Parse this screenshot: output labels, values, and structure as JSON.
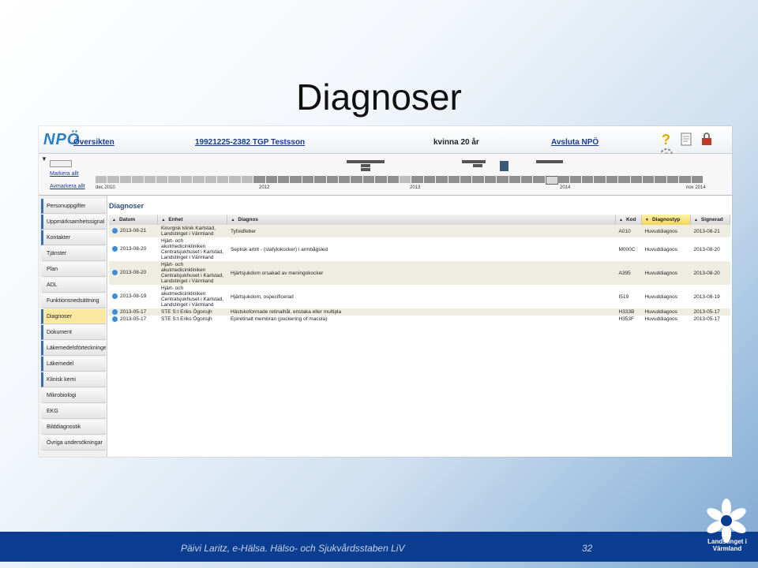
{
  "slide": {
    "title": "Diagnoser",
    "footer_text": "Päivi Laritz, e-Hälsa. Hälso- och Sjukvårdsstaben LiV",
    "page_number": "32",
    "logo_text": "Landstinget i Värmland",
    "colors": {
      "footer": "#0b3d91",
      "accent": "#2a7fbf",
      "active_menu": "#fbe9a1"
    }
  },
  "app": {
    "logo": "NPÖ",
    "nav": {
      "overview": "Översikten",
      "patient": "19921225-2382 TGP Testsson",
      "demographics": "kvinna 20 år",
      "logout": "Avsluta NPÖ"
    },
    "icons": [
      "help-icon",
      "note-icon",
      "lock-icon",
      "settings-icon"
    ]
  },
  "timeline": {
    "mark_all": "Markera allt",
    "unmark_all": "Avmarkera allt",
    "labels": [
      "dec 2010",
      "2012",
      "2013",
      "2014",
      "nov 2014"
    ]
  },
  "menu": [
    "Personuppgifter",
    "Uppmärksamhetssignal",
    "Kontakter",
    "Tjänster",
    "Plan",
    "ADL",
    "Funktionsnedsättning",
    "Diagnoser",
    "Dokument",
    "Läkemedelsförteckningen",
    "Läkemedel",
    "Klinisk kemi",
    "Mikrobiologi",
    "EKG",
    "Bilddiagnostik",
    "Övriga undersökningar"
  ],
  "content": {
    "title": "Diagnoser",
    "columns": [
      "Datum",
      "Enhet",
      "Diagnos",
      "Kod",
      "Diagnostyp",
      "Signerad"
    ],
    "rows": [
      {
        "datum": "2013-08-21",
        "enhet": "Kirurgisk klinik Karlstad, Landstinget i Värmland",
        "diagnos": "Tyfoidfeber",
        "kod": "A010",
        "typ": "Huvuddiagnos",
        "signerad": "2013-08-21"
      },
      {
        "datum": "2013-08-20",
        "enhet": "Hjärt- och akutmedicinkliniken Centralsjukhuset i Karlstad, Landstinget i Värmland",
        "diagnos": "Septisk artrit - (stafylokocker) i armbågsled",
        "kod": "M000C",
        "typ": "Huvuddiagnos",
        "signerad": "2013-08-20"
      },
      {
        "datum": "2013-08-20",
        "enhet": "Hjärt- och akutmedicinkliniken Centralsjukhuset i Karlstad, Landstinget i Värmland",
        "diagnos": "Hjärtsjukdom orsakad av meningokocker",
        "kod": "A395",
        "typ": "Huvuddiagnos",
        "signerad": "2013-08-20"
      },
      {
        "datum": "2013-08-19",
        "enhet": "Hjärt- och akutmedicinkliniken Centralsjukhuset i Karlstad, Landstinget i Värmland",
        "diagnos": "Hjärtsjukdom, ospecificerad",
        "kod": "I519",
        "typ": "Huvuddiagnos",
        "signerad": "2013-08-19"
      },
      {
        "datum": "2013-05-17",
        "enhet": "STE S:t Eriks Ögonsjh",
        "diagnos": "Hästskoformade retinalhål, enstaka eller multipla",
        "kod": "H333B",
        "typ": "Huvuddiagnos",
        "signerad": "2013-05-17"
      },
      {
        "datum": "2013-05-17",
        "enhet": "STE S:t Eriks Ögonsjh",
        "diagnos": "Epiretinalt membran (puckering of macula)",
        "kod": "H353F",
        "typ": "Huvuddiagnos",
        "signerad": "2013-05-17"
      }
    ]
  }
}
